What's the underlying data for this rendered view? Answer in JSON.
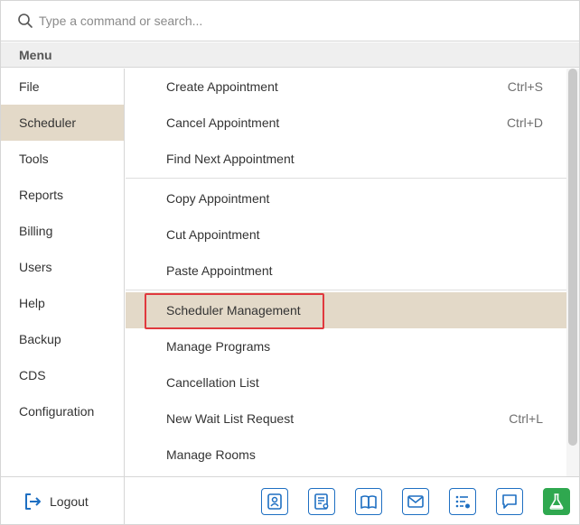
{
  "search": {
    "placeholder": "Type a command or search..."
  },
  "menu_header": "Menu",
  "sidebar": {
    "items": [
      {
        "label": "File"
      },
      {
        "label": "Scheduler",
        "active": true
      },
      {
        "label": "Tools"
      },
      {
        "label": "Reports"
      },
      {
        "label": "Billing"
      },
      {
        "label": "Users"
      },
      {
        "label": "Help"
      },
      {
        "label": "Backup"
      },
      {
        "label": "CDS"
      },
      {
        "label": "Configuration"
      }
    ]
  },
  "submenu": {
    "items": [
      {
        "label": "Create Appointment",
        "shortcut": "Ctrl+S"
      },
      {
        "label": "Cancel Appointment",
        "shortcut": "Ctrl+D"
      },
      {
        "label": "Find Next Appointment",
        "shortcut": ""
      },
      {
        "label": "Copy Appointment",
        "shortcut": ""
      },
      {
        "label": "Cut Appointment",
        "shortcut": ""
      },
      {
        "label": "Paste Appointment",
        "shortcut": ""
      },
      {
        "label": "Scheduler Management",
        "shortcut": "",
        "highlighted": true
      },
      {
        "label": "Manage Programs",
        "shortcut": ""
      },
      {
        "label": "Cancellation List",
        "shortcut": ""
      },
      {
        "label": "New Wait List Request",
        "shortcut": "Ctrl+L"
      },
      {
        "label": "Manage Rooms",
        "shortcut": ""
      }
    ]
  },
  "footer": {
    "logout_label": "Logout",
    "toolbar_icons": [
      "contact-card-icon",
      "form-list-icon",
      "open-book-icon",
      "envelope-icon",
      "task-list-icon",
      "chat-bubble-icon",
      "flask-icon"
    ]
  },
  "colors": {
    "active_background": "#e3d9c8",
    "selection_border": "#e0393e",
    "toolbar_accent": "#1e6fc2",
    "flask_button": "#2fa84f"
  }
}
